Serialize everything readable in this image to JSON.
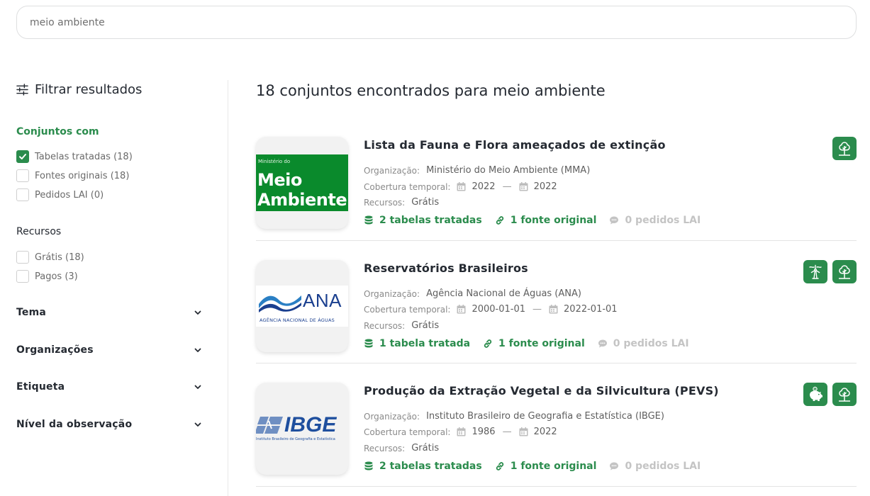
{
  "search": {
    "value": "meio ambiente",
    "placeholder": ""
  },
  "sidebar": {
    "title": "Filtrar resultados",
    "sections": {
      "conjuntos": {
        "label": "Conjuntos com",
        "options": [
          {
            "label": "Tabelas tratadas (18)",
            "checked": true
          },
          {
            "label": "Fontes originais (18)",
            "checked": false
          },
          {
            "label": "Pedidos LAI (0)",
            "checked": false
          }
        ]
      },
      "recursos": {
        "label": "Recursos",
        "options": [
          {
            "label": "Grátis (18)",
            "checked": false
          },
          {
            "label": "Pagos (3)",
            "checked": false
          }
        ]
      }
    },
    "accordions": [
      "Tema",
      "Organizações",
      "Etiqueta",
      "Nível da observação"
    ]
  },
  "results": {
    "heading": "18 conjuntos encontrados para meio ambiente",
    "meta_labels": {
      "org": "Organização:",
      "cov": "Cobertura temporal:",
      "res": "Recursos:"
    },
    "items": [
      {
        "title": "Lista da Fauna e Flora ameaçados de extinção",
        "organization": "Ministério do Meio Ambiente (MMA)",
        "coverage_start": "2022",
        "coverage_end": "2022",
        "resources": "Grátis",
        "tables": "2 tabelas tratadas",
        "sources": "1 fonte original",
        "requests": "0 pedidos LAI",
        "logo": {
          "small": "Ministério do",
          "line1": "Meio",
          "line2": "Ambiente"
        },
        "badges": [
          "tree-icon"
        ]
      },
      {
        "title": "Reservatórios Brasileiros",
        "organization": "Agência Nacional de Águas (ANA)",
        "coverage_start": "2000-01-01",
        "coverage_end": "2022-01-01",
        "resources": "Grátis",
        "tables": "1 tabela tratada",
        "sources": "1 fonte original",
        "requests": "0 pedidos LAI",
        "logo": {
          "main": "ANA",
          "sub": "AGÊNCIA NACIONAL DE ÁGUAS"
        },
        "badges": [
          "energy-icon",
          "tree-icon"
        ]
      },
      {
        "title": "Produção da Extração Vegetal e da Silvicultura (PEVS)",
        "organization": "Instituto Brasileiro de Geografia e Estatística (IBGE)",
        "coverage_start": "1986",
        "coverage_end": "2022",
        "resources": "Grátis",
        "tables": "2 tabelas tratadas",
        "sources": "1 fonte original",
        "requests": "0 pedidos LAI",
        "logo": {
          "main": "IBGE",
          "sub": "Instituto Brasileiro de Geografia e Estatística"
        },
        "badges": [
          "piggy-bank-icon",
          "tree-icon"
        ]
      }
    ]
  },
  "colors": {
    "accent": "#2b8c4d",
    "text": "#252a32",
    "muted": "#8a8a8a",
    "disabled": "#c4c4c4"
  }
}
